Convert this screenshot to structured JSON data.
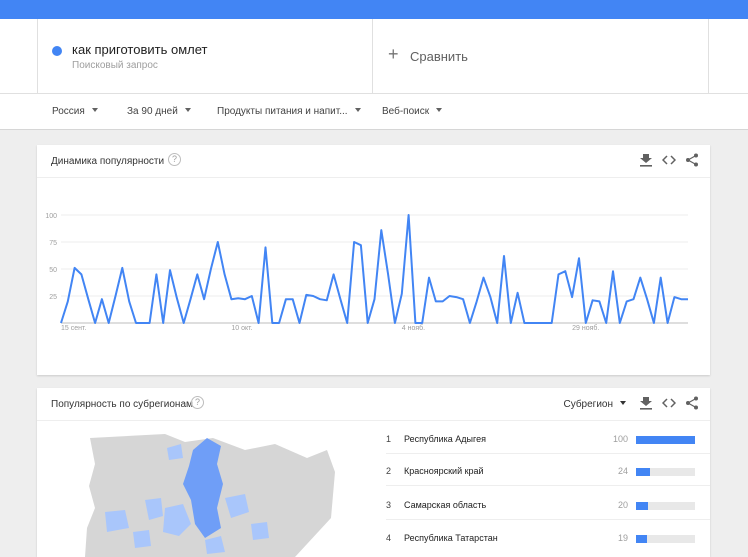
{
  "header": {
    "bar_color": "#4285f4"
  },
  "search_term": {
    "label": "как приготовить омлет",
    "type": "Поисковый запрос",
    "color": "#4285f4"
  },
  "compare": {
    "icon": "plus-icon",
    "label": "Сравнить"
  },
  "filters": [
    {
      "label": "Россия"
    },
    {
      "label": "За 90 дней"
    },
    {
      "label": "Продукты питания и напит..."
    },
    {
      "label": "Веб-поиск"
    }
  ],
  "interest_over_time": {
    "title": "Динамика популярности",
    "icons": [
      "download-icon",
      "embed-icon",
      "share-icon"
    ]
  },
  "chart_data": {
    "type": "line",
    "title": "",
    "xlabel": "",
    "ylabel": "",
    "ylim": [
      0,
      100
    ],
    "yticks": [
      25,
      50,
      75,
      100
    ],
    "xtick_labels": [
      {
        "index": 0,
        "label": "15 сент."
      },
      {
        "index": 25,
        "label": "10 окт."
      },
      {
        "index": 50,
        "label": "4 нояб."
      },
      {
        "index": 75,
        "label": "29 нояб."
      }
    ],
    "grid": true,
    "series": [
      {
        "color": "#4285f4",
        "values": [
          0,
          20,
          51,
          45,
          22,
          0,
          22,
          0,
          25,
          51,
          20,
          0,
          0,
          0,
          45,
          0,
          49,
          23,
          0,
          22,
          45,
          22,
          50,
          75,
          45,
          22,
          23,
          22,
          25,
          0,
          70,
          0,
          0,
          22,
          22,
          0,
          26,
          25,
          22,
          21,
          45,
          22,
          0,
          75,
          72,
          0,
          22,
          86,
          45,
          0,
          27,
          100,
          0,
          0,
          42,
          20,
          20,
          25,
          24,
          22,
          0,
          20,
          42,
          24,
          0,
          62,
          0,
          28,
          0,
          0,
          0,
          0,
          0,
          45,
          48,
          24,
          60,
          0,
          21,
          20,
          0,
          48,
          0,
          20,
          22,
          42,
          22,
          0,
          42,
          0,
          24,
          22,
          22
        ]
      }
    ]
  },
  "subregions": {
    "title": "Популярность по субрегионам",
    "select_label": "Субрегион",
    "icons": [
      "download-icon",
      "embed-icon",
      "share-icon"
    ],
    "rows": [
      {
        "rank": "1",
        "name": "Республика Адыгея",
        "value": "100",
        "fraction": 1.0
      },
      {
        "rank": "2",
        "name": "Красноярский край",
        "value": "24",
        "fraction": 0.24
      },
      {
        "rank": "3",
        "name": "Самарская область",
        "value": "20",
        "fraction": 0.2
      },
      {
        "rank": "4",
        "name": "Республика Татарстан",
        "value": "19",
        "fraction": 0.19
      }
    ]
  }
}
